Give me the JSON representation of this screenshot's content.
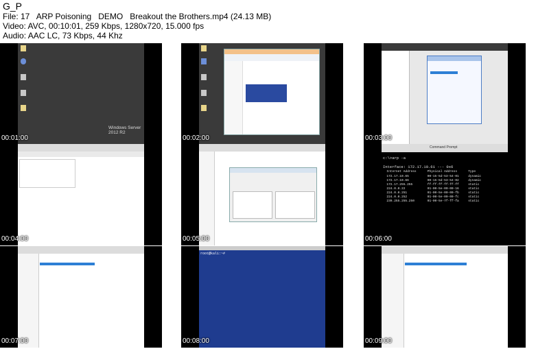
{
  "app_title": "G_P",
  "info": {
    "file": "File: 17   ARP Poisoning   DEMO   Breakout the Brothers.mp4 (24.13 MB)",
    "video": "Video: AVC, 00:10:01, 259 Kbps, 1280x720, 15.000 fps",
    "audio": "Audio: AAC LC, 73 Kbps, 44 Khz"
  },
  "thumbnails": [
    {
      "timestamp": "00:01:00",
      "os_label": "Windows Server 2012 R2"
    },
    {
      "timestamp": "00:02:00"
    },
    {
      "timestamp": "00:03:00"
    },
    {
      "timestamp": "00:04:00"
    },
    {
      "timestamp": "00:05:00"
    },
    {
      "timestamp": "00:06:00",
      "cmd": {
        "title": "Command Prompt",
        "prompt": "c:\\>arp -a",
        "interface": "Interface: 172.17.10.61 --- 0x6",
        "header": "  Internet Address      Physical Address      Type",
        "rows": [
          "  172.17.10.65          00-15-5d-53-54-01     dynamic",
          "  172.17.10.66          00-15-5d-53-54-02     dynamic",
          "  172.17.255.255        ff-ff-ff-ff-ff-ff     static",
          "  224.0.0.22            01-00-5e-00-00-16     static",
          "  224.0.0.251           01-00-5e-00-00-fb     static",
          "  224.0.0.252           01-00-5e-00-00-fc     static",
          "  239.255.255.250       01-00-5e-7f-ff-fa     static"
        ]
      }
    },
    {
      "timestamp": "00:07:00"
    },
    {
      "timestamp": "00:08:00",
      "terminal_prompt": "root@kali:~# "
    },
    {
      "timestamp": "00:09:00"
    }
  ],
  "colors": {
    "desktop": "#3c3c3c",
    "win_blue": "#1f3c8f",
    "cmd_bg": "#000000",
    "select_bar": "#2d7fd5"
  }
}
